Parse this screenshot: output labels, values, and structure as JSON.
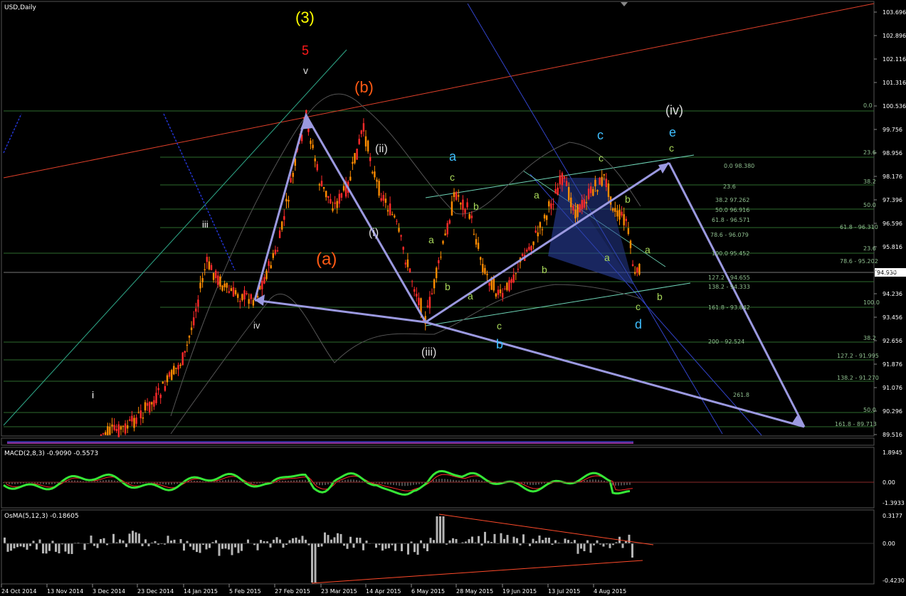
{
  "window": {
    "main_title": "USD,Daily",
    "price_badge": "94.930",
    "macd_title": "MACD(2,8,3) -0.9090 -0.5573",
    "osma_title": "OsMA(5,12,3) -0.18605"
  },
  "axes": {
    "price_ticks": [
      "103.696",
      "102.896",
      "102.116",
      "101.316",
      "100.536",
      "99.756",
      "98.956",
      "98.176",
      "97.396",
      "96.596",
      "95.816",
      "95.036",
      "94.236",
      "93.456",
      "92.656",
      "91.876",
      "91.076",
      "90.296",
      "89.516"
    ],
    "macd_ticks": [
      "1.8945",
      "0.00",
      "-1.3933"
    ],
    "osma_ticks": [
      "0.3177",
      "0.00",
      "-0.4230"
    ],
    "dates": [
      "24 Oct 2014",
      "13 Nov 2014",
      "3 Dec 2014",
      "23 Dec 2014",
      "14 Jan 2015",
      "5 Feb 2015",
      "27 Feb 2015",
      "23 Mar 2015",
      "14 Apr 2015",
      "6 May 2015",
      "28 May 2015",
      "19 Jun 2015",
      "13 Jul 2015",
      "4 Aug 2015"
    ]
  },
  "fib_labels": [
    "0.0",
    "23.6",
    "0.0 98.380",
    "38.2",
    "23.6",
    "38.2 97.262",
    "50.0",
    "50.0 96.916",
    "61.8 - 96.571",
    "61.8 - 96.310",
    "78.6 - 96.079",
    "23.6",
    "100.0 95.452",
    "78.6 - 95.202",
    "127.2 - 94.655",
    "138.2 - 94.333",
    "100.0",
    "161.8 - 93.842",
    "38.2",
    "200 - 92.524",
    "127.2 - 91.995",
    "138.2 - 91.270",
    "261.8",
    "50.0",
    "161.8 - 89.713"
  ],
  "wave_labels": {
    "deg3": "(3)",
    "five": "5",
    "v": "v",
    "b_paren": "(b)",
    "a_paren": "(a)",
    "iii": "iii",
    "iv_small": "iv",
    "i_small": "i",
    "ii_paren": "(ii)",
    "i_paren": "(i)",
    "iii_paren": "(iii)",
    "iv_paren": "(iv)",
    "blue_a": "a",
    "blue_b": "b",
    "blue_c": "c",
    "blue_d": "d",
    "blue_e": "e",
    "g_c1": "c",
    "g_b1": "b",
    "g_a1": "a",
    "g_b2": "b",
    "g_a2": "a",
    "g_c2": "c",
    "g_a3": "a",
    "g_b3": "b",
    "g_c3": "c",
    "g_a4": "a",
    "g_b4": "b",
    "g_c4": "c",
    "g_a5": "a",
    "g_b5": "b",
    "g_c5": "c"
  },
  "colors": {
    "bull": "#ff8c00",
    "bear": "#ff2a2a",
    "macd": "#36e636",
    "trend": "#9b99e0",
    "yellow": "#ffff00",
    "orange": "#ff5a14",
    "cyan": "#3fbfff",
    "wave_green": "#a8d85a"
  },
  "chart_data": [
    {
      "type": "candlestick",
      "title": "USD,Daily",
      "ylim": [
        89.5,
        103.7
      ],
      "x_range": [
        "2014-10-24",
        "2015-08-21"
      ],
      "key_points": [
        {
          "label": "iv",
          "date": "2015-02-10",
          "price": 93.9
        },
        {
          "label": "5 / v (3)",
          "date": "2015-03-13",
          "price": 100.3
        },
        {
          "label": "(iii)",
          "date": "2015-05-14",
          "price": 93.1
        },
        {
          "label": "c",
          "date": "2015-07-20",
          "price": 98.3
        },
        {
          "label": "d",
          "date": "2015-08-18",
          "price": 94.2
        }
      ],
      "last_price": 94.93
    },
    {
      "type": "bar",
      "title": "MACD(2,8,3) -0.9090 -0.5573",
      "ylim": [
        -1.3933,
        1.8945
      ],
      "values": [
        -0.909,
        -0.5573
      ]
    },
    {
      "type": "bar",
      "title": "OsMA(5,12,3) -0.18605",
      "ylim": [
        -0.423,
        0.3177
      ],
      "values": [
        -0.18605
      ]
    }
  ]
}
